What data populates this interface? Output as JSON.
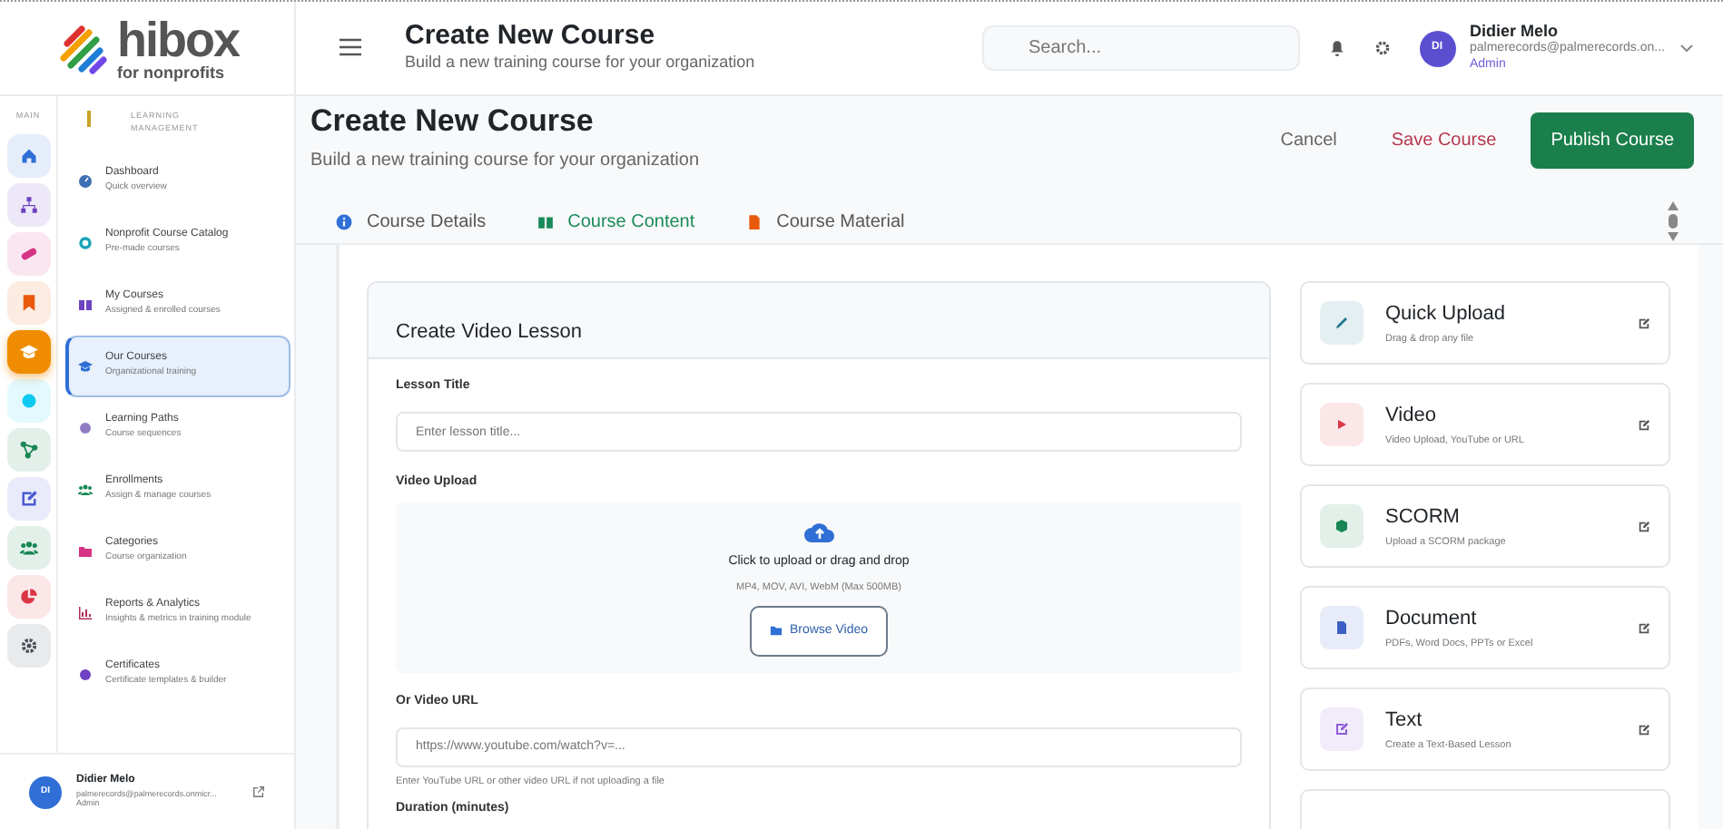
{
  "logo": {
    "name": "hibox",
    "tagline": "for nonprofits"
  },
  "header": {
    "title": "Create New Course",
    "subtitle": "Build a new training course for your organization",
    "search": {
      "placeholder": "Search..."
    },
    "user": {
      "initials": "DI",
      "name": "Didier Melo",
      "email": "palmerecords@palmerecords.on...",
      "role": "Admin"
    }
  },
  "rail": {
    "label": "MAIN",
    "items": [
      {
        "kind": "home",
        "color": "#2f6fd6",
        "selected": false
      },
      {
        "kind": "hierarchy",
        "color": "#6f42c1",
        "selected": false
      },
      {
        "kind": "pill",
        "color": "#d63384",
        "selected": false
      },
      {
        "kind": "bookmark",
        "color": "#e8590c",
        "selected": false
      },
      {
        "kind": "graduation",
        "color": "#f08c00",
        "selected": true
      },
      {
        "kind": "dot",
        "color": "#0dcaf0",
        "selected": false
      },
      {
        "kind": "network",
        "color": "#198754",
        "selected": false
      },
      {
        "kind": "edit",
        "color": "#4c5bd4",
        "selected": false
      },
      {
        "kind": "users",
        "color": "#198754",
        "selected": false
      },
      {
        "kind": "pie",
        "color": "#dc3545",
        "selected": false
      },
      {
        "kind": "gear",
        "color": "#495057",
        "selected": false
      }
    ]
  },
  "sidebar": {
    "section": "LEARNING MANAGEMENT",
    "items": [
      {
        "kind": "gauge",
        "color": "#3d6fb5",
        "title": "Dashboard",
        "subtitle": "Quick overview",
        "selected": false
      },
      {
        "kind": "ring",
        "color": "#1aa3b8",
        "title": "Nonprofit Course Catalog",
        "subtitle": "Pre-made courses",
        "selected": false
      },
      {
        "kind": "book",
        "color": "#6f42c1",
        "title": "My Courses",
        "subtitle": "Assigned & enrolled courses",
        "selected": false
      },
      {
        "kind": "graduation",
        "color": "#2f6fd6",
        "title": "Our Courses",
        "subtitle": "Organizational training",
        "selected": true
      },
      {
        "kind": "dot",
        "color": "#8e7cc3",
        "title": "Learning Paths",
        "subtitle": "Course sequences",
        "selected": false
      },
      {
        "kind": "users",
        "color": "#198754",
        "title": "Enrollments",
        "subtitle": "Assign & manage courses",
        "selected": false
      },
      {
        "kind": "folder",
        "color": "#d63384",
        "title": "Categories",
        "subtitle": "Course organization",
        "selected": false
      },
      {
        "kind": "chart",
        "color": "#b02a5b",
        "title": "Reports & Analytics",
        "subtitle": "Insights & metrics in training module",
        "selected": false
      },
      {
        "kind": "dot",
        "color": "#6f42c1",
        "title": "Certificates",
        "subtitle": "Certificate templates & builder",
        "selected": false
      }
    ],
    "user": {
      "initials": "DI",
      "name": "Didier Melo",
      "email": "palmerecords@palmerecords.onmicr...",
      "role": "Admin"
    }
  },
  "page": {
    "title": "Create New Course",
    "subtitle": "Build a new training course for your organization",
    "buttons": [
      {
        "label": "Cancel",
        "kind": "plain"
      },
      {
        "label": "Save Course",
        "kind": "danger"
      },
      {
        "label": "Publish Course",
        "kind": "primary"
      }
    ]
  },
  "tabs": [
    {
      "label": "Course Details",
      "kind": "info",
      "selected": false
    },
    {
      "label": "Course Content",
      "kind": "book",
      "selected": true
    },
    {
      "label": "Course Material",
      "kind": "file",
      "selected": false
    }
  ],
  "lesson_form": {
    "title": "Create Video Lesson",
    "lesson_title": {
      "label": "Lesson Title",
      "placeholder": "Enter lesson title..."
    },
    "upload": {
      "label": "Video Upload",
      "prompt": "Click to upload or drag and drop",
      "formats": "MP4, MOV, AVI, WebM (Max 500MB)",
      "button": "Browse Video"
    },
    "url": {
      "label": "Or Video URL",
      "placeholder": "https://www.youtube.com/watch?v=...",
      "help": "Enter YouTube URL or other video URL if not uploading a file"
    },
    "duration": {
      "label": "Duration (minutes)"
    }
  },
  "content_types": [
    {
      "kind": "pencil",
      "color": "#1f7a8c",
      "title": "Quick Upload",
      "subtitle": "Drag & drop any file"
    },
    {
      "kind": "play",
      "color": "#dc3545",
      "title": "Video",
      "subtitle": "Video Upload, YouTube or URL"
    },
    {
      "kind": "cube",
      "color": "#198754",
      "title": "SCORM",
      "subtitle": "Upload a SCORM package"
    },
    {
      "kind": "file",
      "color": "#3d5fc4",
      "title": "Document",
      "subtitle": "PDFs, Word Docs, PPTs or Excel"
    },
    {
      "kind": "edit",
      "color": "#8e5cd6",
      "title": "Text",
      "subtitle": "Create a Text-Based Lesson"
    }
  ]
}
